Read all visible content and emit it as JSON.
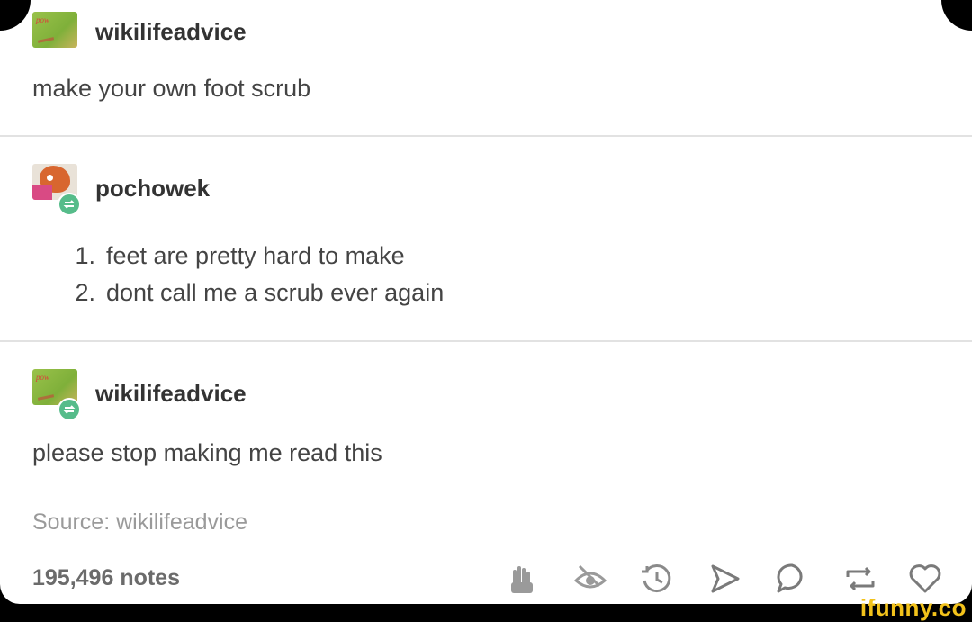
{
  "posts": [
    {
      "username": "wikilifeadvice",
      "avatar_icon": "wikilifeadvice-avatar-icon",
      "avatar_tag": "pow",
      "text": "make your own foot scrub"
    },
    {
      "username": "pochowek",
      "avatar_icon": "fox-avatar-icon",
      "reblog_icon": "reblog-icon",
      "list": [
        {
          "num": "1.",
          "text": "feet are pretty hard to make"
        },
        {
          "num": "2.",
          "text": "dont call me a scrub ever again"
        }
      ]
    },
    {
      "username": "wikilifeadvice",
      "avatar_icon": "wikilifeadvice-avatar-icon",
      "avatar_tag": "pow",
      "reblog_icon": "reblog-icon",
      "text": "please stop making me read this"
    }
  ],
  "footer": {
    "source": "Source: wikilifeadvice",
    "notes": "195,496 notes",
    "actions": [
      "hand-icon",
      "eye-icon",
      "clock-icon",
      "send-icon",
      "comment-icon",
      "reblog-icon",
      "heart-icon"
    ]
  },
  "watermark": "ifunny.co",
  "colors": {
    "username": "#333333",
    "text": "#444444",
    "source": "#9a9a9a",
    "notes": "#6b6b6b",
    "reblog_badge": "#56bc8a",
    "watermark": "#f2c21b"
  }
}
